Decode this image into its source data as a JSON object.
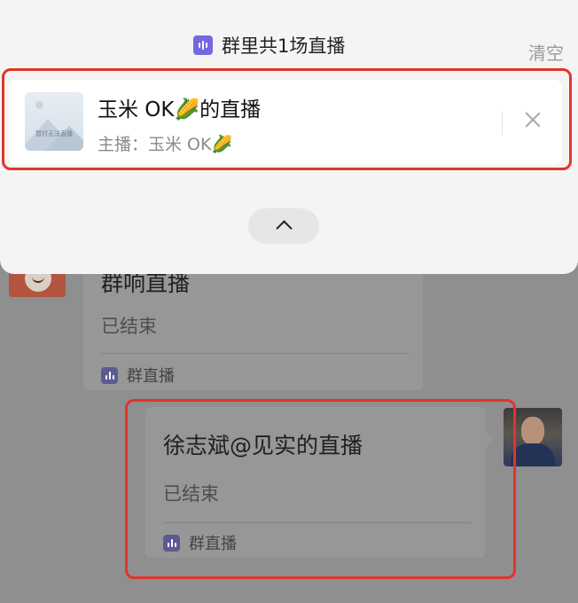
{
  "panel": {
    "header_title": "群里共1场直播",
    "clear_label": "清空",
    "live_item": {
      "title": "玉米 OK🌽的直播",
      "host": "主播：玉米 OK🌽",
      "thumbnail_caption": "暂时无法直播"
    }
  },
  "chat": {
    "messages": [
      {
        "title": "群响直播",
        "status": "已结束",
        "footer_label": "群直播"
      },
      {
        "title": "徐志斌@见实的直播",
        "status": "已结束",
        "footer_label": "群直播"
      }
    ]
  },
  "colors": {
    "accent": "#7468e0",
    "highlight_box": "#e23428",
    "panel_bg": "#f4f4f4",
    "overlay": "#8e8e8e"
  },
  "icons": [
    "live-audio-icon",
    "close-icon",
    "chevron-up-icon",
    "image-placeholder-icon"
  ]
}
